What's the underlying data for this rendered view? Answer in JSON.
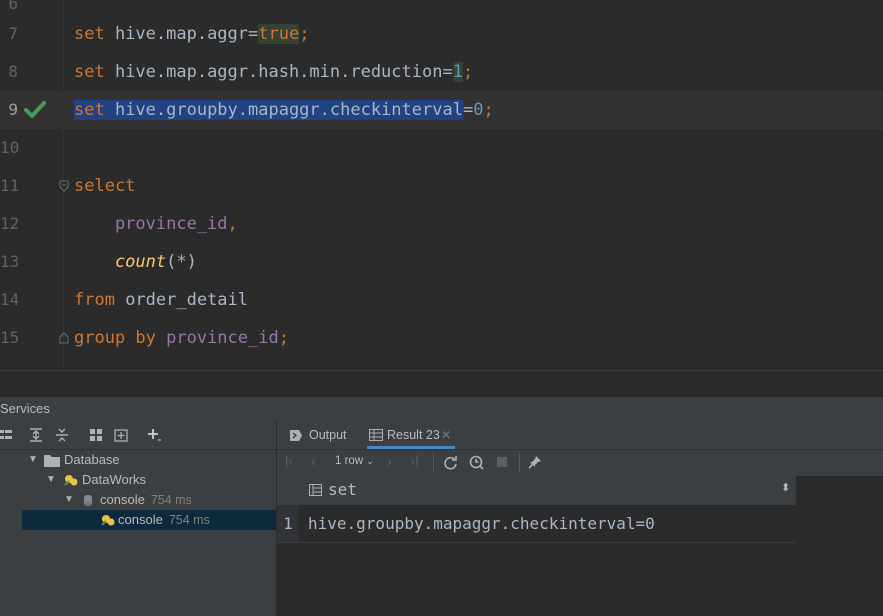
{
  "editor": {
    "partial_line_number": "6",
    "lines": [
      {
        "n": "7"
      },
      {
        "n": "8"
      },
      {
        "n": "9"
      },
      {
        "n": "10"
      },
      {
        "n": "11"
      },
      {
        "n": "12"
      },
      {
        "n": "13"
      },
      {
        "n": "14"
      },
      {
        "n": "15"
      }
    ],
    "tokens": {
      "l7_kw": "set",
      "l7_a": " hive.map.aggr=",
      "l7_b": "true",
      "l7_c": ";",
      "l8_kw": "set",
      "l8_a": " hive.map.aggr.hash.min.reduction=",
      "l8_b": "1",
      "l8_c": ";",
      "l9_kw": "set",
      "l9_a": " hive.groupby.mapaggr.checkinterval",
      "l9_b": "=",
      "l9_c": "0",
      "l9_d": ";",
      "l11_kw": "select",
      "l12_col": "    province_id",
      "l12_p": ",",
      "l13_fn": "    count",
      "l13_p": "(*)",
      "l14_kw": "from",
      "l14_a": " order_detail",
      "l15_kw": "group by",
      "l15_col": " province_id",
      "l15_p": ";"
    }
  },
  "services": {
    "title": "Services",
    "tree": {
      "database": "Database",
      "dataworks": "DataWorks",
      "console_parent": "console",
      "console_parent_time": "754 ms",
      "console_child": "console",
      "console_child_time": "754 ms"
    },
    "tabs": {
      "output": "Output",
      "result": "Result 23"
    },
    "toolbar": {
      "rows": "1 row"
    },
    "grid": {
      "column": "set",
      "row_number": "1",
      "value": "hive.groupby.mapaggr.checkinterval=0"
    }
  },
  "colors": {
    "keyword": "#cc7832",
    "number": "#6897bb",
    "function": "#ffc66d",
    "column": "#9876aa",
    "selection": "#214283",
    "check": "#499c54"
  }
}
